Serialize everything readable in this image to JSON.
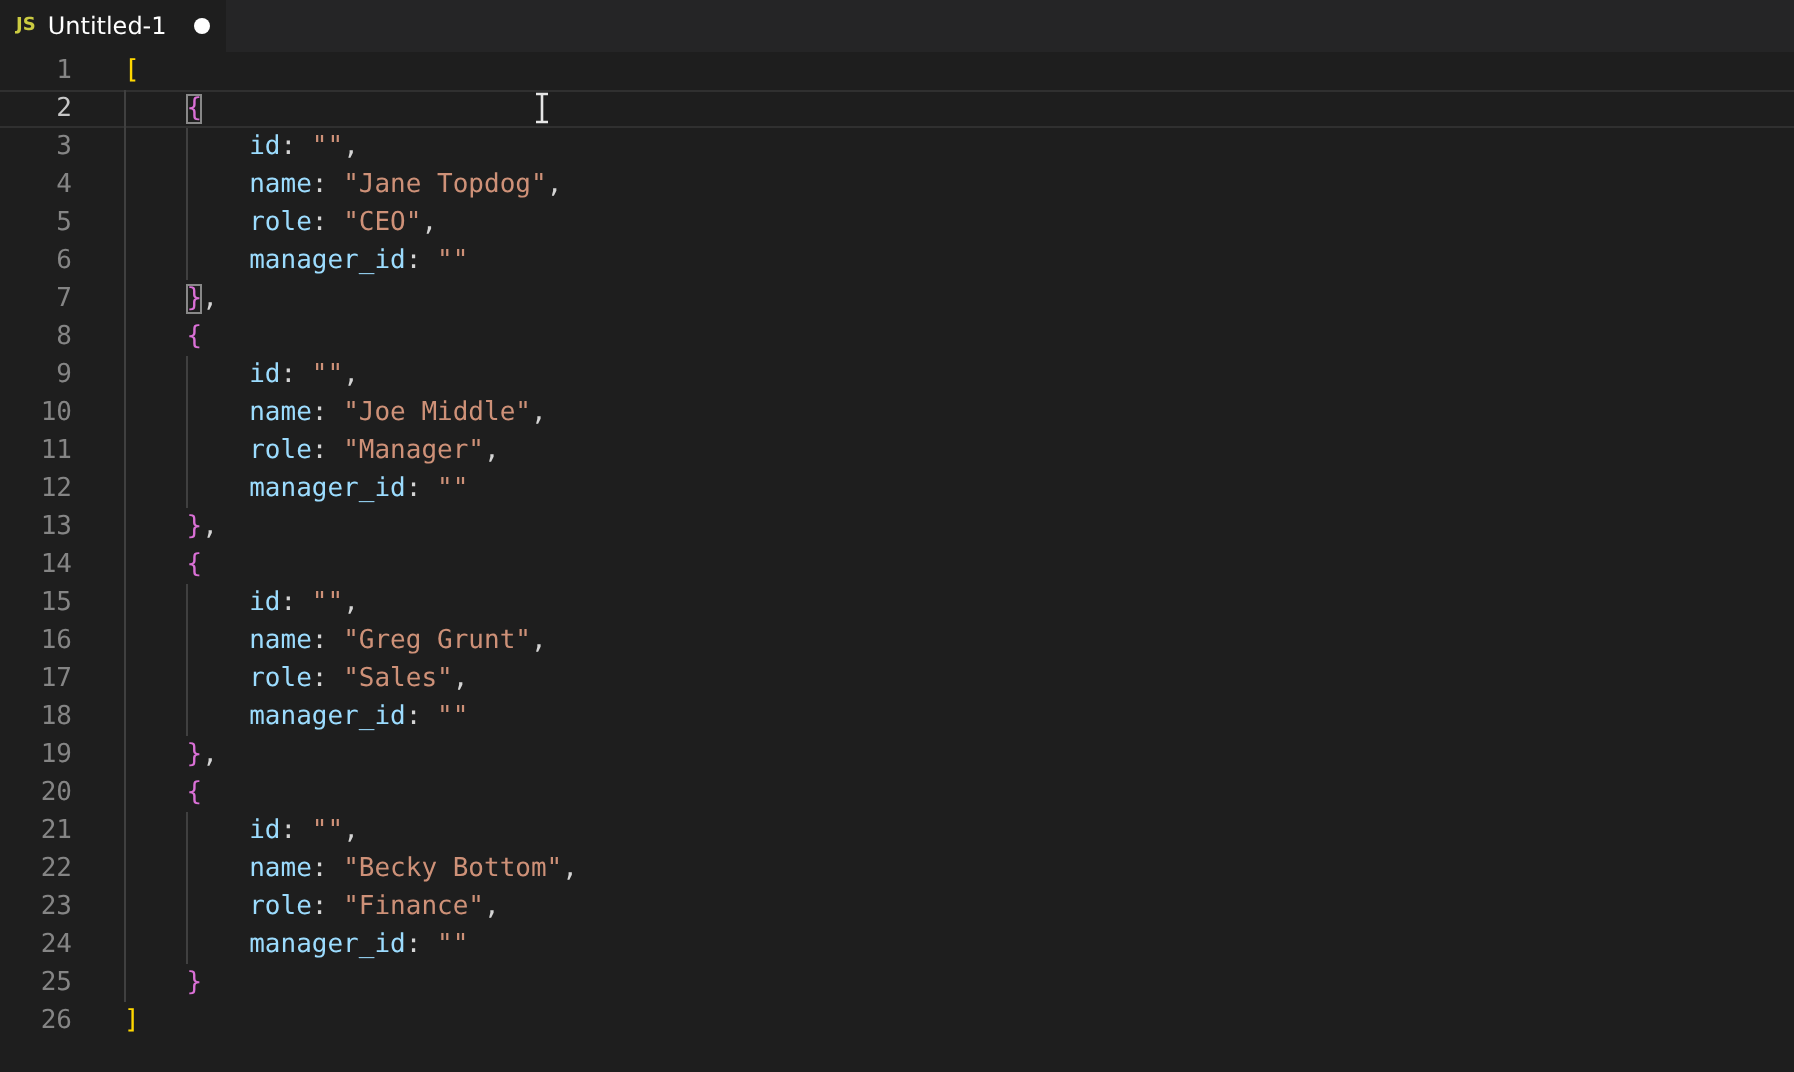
{
  "tab": {
    "badge": "JS",
    "title": "Untitled-1",
    "unsaved": true,
    "selected": true
  },
  "editor": {
    "lines": [
      {
        "number": "1",
        "current": false,
        "tokens": [
          {
            "kind": "bracket",
            "text": "[",
            "color": "#ffd700",
            "matched": false
          }
        ],
        "children": [
          {
            "number": "2",
            "current": true,
            "tokens": [
              {
                "kind": "bracket",
                "text": "{",
                "color": "#da70d6",
                "matched": true
              }
            ],
            "children": [
              {
                "number": "3",
                "current": false,
                "tokens": [
                  {
                    "kind": "key",
                    "text": "id"
                  },
                  {
                    "kind": "punct",
                    "text": ": "
                  },
                  {
                    "kind": "string",
                    "text": "\"\""
                  },
                  {
                    "kind": "punct",
                    "text": ","
                  }
                ]
              },
              {
                "number": "4",
                "current": false,
                "tokens": [
                  {
                    "kind": "key",
                    "text": "name"
                  },
                  {
                    "kind": "punct",
                    "text": ": "
                  },
                  {
                    "kind": "string",
                    "text": "\"Jane Topdog\""
                  },
                  {
                    "kind": "punct",
                    "text": ","
                  }
                ]
              },
              {
                "number": "5",
                "current": false,
                "tokens": [
                  {
                    "kind": "key",
                    "text": "role"
                  },
                  {
                    "kind": "punct",
                    "text": ": "
                  },
                  {
                    "kind": "string",
                    "text": "\"CEO\""
                  },
                  {
                    "kind": "punct",
                    "text": ","
                  }
                ]
              },
              {
                "number": "6",
                "current": false,
                "tokens": [
                  {
                    "kind": "key",
                    "text": "manager_id"
                  },
                  {
                    "kind": "punct",
                    "text": ": "
                  },
                  {
                    "kind": "string",
                    "text": "\"\""
                  }
                ]
              }
            ]
          },
          {
            "number": "7",
            "current": false,
            "tokens": [
              {
                "kind": "bracket",
                "text": "}",
                "color": "#da70d6",
                "matched": true
              },
              {
                "kind": "punct",
                "text": ","
              }
            ]
          },
          {
            "number": "8",
            "current": false,
            "tokens": [
              {
                "kind": "bracket",
                "text": "{",
                "color": "#da70d6",
                "matched": false
              }
            ],
            "children": [
              {
                "number": "9",
                "current": false,
                "tokens": [
                  {
                    "kind": "key",
                    "text": "id"
                  },
                  {
                    "kind": "punct",
                    "text": ": "
                  },
                  {
                    "kind": "string",
                    "text": "\"\""
                  },
                  {
                    "kind": "punct",
                    "text": ","
                  }
                ]
              },
              {
                "number": "10",
                "current": false,
                "tokens": [
                  {
                    "kind": "key",
                    "text": "name"
                  },
                  {
                    "kind": "punct",
                    "text": ": "
                  },
                  {
                    "kind": "string",
                    "text": "\"Joe Middle\""
                  },
                  {
                    "kind": "punct",
                    "text": ","
                  }
                ]
              },
              {
                "number": "11",
                "current": false,
                "tokens": [
                  {
                    "kind": "key",
                    "text": "role"
                  },
                  {
                    "kind": "punct",
                    "text": ": "
                  },
                  {
                    "kind": "string",
                    "text": "\"Manager\""
                  },
                  {
                    "kind": "punct",
                    "text": ","
                  }
                ]
              },
              {
                "number": "12",
                "current": false,
                "tokens": [
                  {
                    "kind": "key",
                    "text": "manager_id"
                  },
                  {
                    "kind": "punct",
                    "text": ": "
                  },
                  {
                    "kind": "string",
                    "text": "\"\""
                  }
                ]
              }
            ]
          },
          {
            "number": "13",
            "current": false,
            "tokens": [
              {
                "kind": "bracket",
                "text": "}",
                "color": "#da70d6",
                "matched": false
              },
              {
                "kind": "punct",
                "text": ","
              }
            ]
          },
          {
            "number": "14",
            "current": false,
            "tokens": [
              {
                "kind": "bracket",
                "text": "{",
                "color": "#da70d6",
                "matched": false
              }
            ],
            "children": [
              {
                "number": "15",
                "current": false,
                "tokens": [
                  {
                    "kind": "key",
                    "text": "id"
                  },
                  {
                    "kind": "punct",
                    "text": ": "
                  },
                  {
                    "kind": "string",
                    "text": "\"\""
                  },
                  {
                    "kind": "punct",
                    "text": ","
                  }
                ]
              },
              {
                "number": "16",
                "current": false,
                "tokens": [
                  {
                    "kind": "key",
                    "text": "name"
                  },
                  {
                    "kind": "punct",
                    "text": ": "
                  },
                  {
                    "kind": "string",
                    "text": "\"Greg Grunt\""
                  },
                  {
                    "kind": "punct",
                    "text": ","
                  }
                ]
              },
              {
                "number": "17",
                "current": false,
                "tokens": [
                  {
                    "kind": "key",
                    "text": "role"
                  },
                  {
                    "kind": "punct",
                    "text": ": "
                  },
                  {
                    "kind": "string",
                    "text": "\"Sales\""
                  },
                  {
                    "kind": "punct",
                    "text": ","
                  }
                ]
              },
              {
                "number": "18",
                "current": false,
                "tokens": [
                  {
                    "kind": "key",
                    "text": "manager_id"
                  },
                  {
                    "kind": "punct",
                    "text": ": "
                  },
                  {
                    "kind": "string",
                    "text": "\"\""
                  }
                ]
              }
            ]
          },
          {
            "number": "19",
            "current": false,
            "tokens": [
              {
                "kind": "bracket",
                "text": "}",
                "color": "#da70d6",
                "matched": false
              },
              {
                "kind": "punct",
                "text": ","
              }
            ]
          },
          {
            "number": "20",
            "current": false,
            "tokens": [
              {
                "kind": "bracket",
                "text": "{",
                "color": "#da70d6",
                "matched": false
              }
            ],
            "children": [
              {
                "number": "21",
                "current": false,
                "tokens": [
                  {
                    "kind": "key",
                    "text": "id"
                  },
                  {
                    "kind": "punct",
                    "text": ": "
                  },
                  {
                    "kind": "string",
                    "text": "\"\""
                  },
                  {
                    "kind": "punct",
                    "text": ","
                  }
                ]
              },
              {
                "number": "22",
                "current": false,
                "tokens": [
                  {
                    "kind": "key",
                    "text": "name"
                  },
                  {
                    "kind": "punct",
                    "text": ": "
                  },
                  {
                    "kind": "string",
                    "text": "\"Becky Bottom\""
                  },
                  {
                    "kind": "punct",
                    "text": ","
                  }
                ]
              },
              {
                "number": "23",
                "current": false,
                "tokens": [
                  {
                    "kind": "key",
                    "text": "role"
                  },
                  {
                    "kind": "punct",
                    "text": ": "
                  },
                  {
                    "kind": "string",
                    "text": "\"Finance\""
                  },
                  {
                    "kind": "punct",
                    "text": ","
                  }
                ]
              },
              {
                "number": "24",
                "current": false,
                "tokens": [
                  {
                    "kind": "key",
                    "text": "manager_id"
                  },
                  {
                    "kind": "punct",
                    "text": ": "
                  },
                  {
                    "kind": "string",
                    "text": "\"\""
                  }
                ]
              }
            ]
          },
          {
            "number": "25",
            "current": false,
            "tokens": [
              {
                "kind": "bracket",
                "text": "}",
                "color": "#da70d6",
                "matched": false
              }
            ]
          }
        ]
      },
      {
        "number": "26",
        "current": false,
        "tokens": [
          {
            "kind": "bracket",
            "text": "]",
            "color": "#ffd700",
            "matched": false
          }
        ]
      }
    ]
  }
}
